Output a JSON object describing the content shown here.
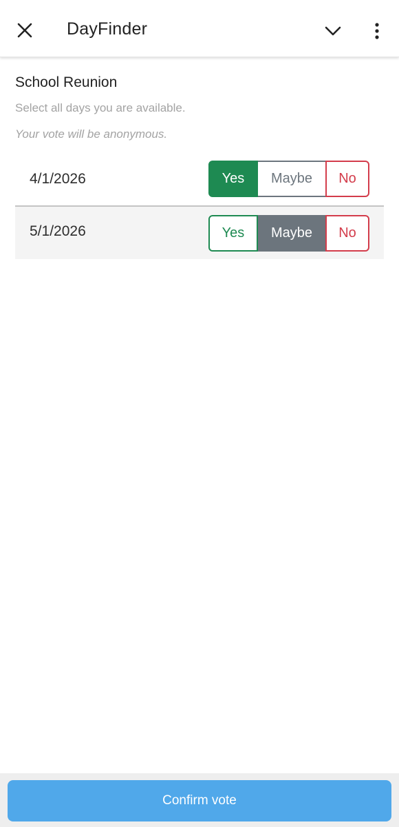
{
  "header": {
    "title": "DayFinder",
    "icons": [
      "close-icon",
      "chevron-down-icon",
      "more-vertical-icon"
    ]
  },
  "poll": {
    "title": "School Reunion",
    "instruction": "Select all days you are available.",
    "note": "Your vote will be anonymous."
  },
  "options": [
    {
      "date": "4/1/2026",
      "yes_label": "Yes",
      "maybe_label": "Maybe",
      "no_label": "No",
      "selected": "Yes"
    },
    {
      "date": "5/1/2026",
      "yes_label": "Yes",
      "maybe_label": "Maybe",
      "no_label": "No",
      "selected": "Maybe"
    }
  ],
  "footer": {
    "confirm_label": "Confirm vote"
  },
  "colors": {
    "yes": "#1e8a52",
    "maybe": "#6c757d",
    "no": "#d33c4b",
    "confirm": "#50a8ea"
  }
}
